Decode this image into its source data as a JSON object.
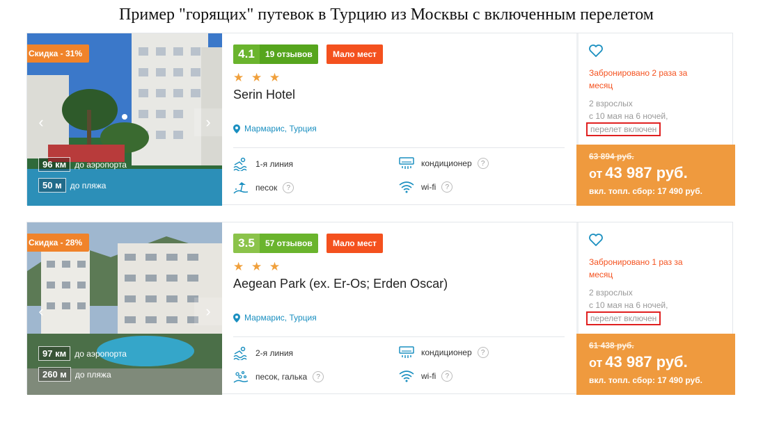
{
  "page": {
    "title": "Пример \"горящих\" путевок в Турцию из Москвы с включенным перелетом"
  },
  "labels": {
    "few_places": "Мало мест",
    "to_airport": "до аэропорта",
    "to_beach": "до пляжа",
    "question": "?"
  },
  "hotels": [
    {
      "discount": "Скидка - 31%",
      "rating": "4.1",
      "reviews": "19 отзывов",
      "stars": "★ ★ ★",
      "name": "Serin Hotel",
      "location": "Мармарис, Турция",
      "airport_km": "96 км",
      "beach_m": "50 м",
      "amenities": {
        "line": "1-я линия",
        "ac": "кондиционер",
        "beach": "песок",
        "wifi": "wi-fi"
      },
      "booked": "Забронировано 2 раза за месяц",
      "tourists": "2 взрослых",
      "dates": "с 10 мая на 6 ночей,",
      "flight": "перелет включен",
      "old_price": "63 894 руб.",
      "price_from": "от",
      "price": "43 987 руб.",
      "fee": "вкл. топл. сбор: 17 490 руб."
    },
    {
      "discount": "Скидка - 28%",
      "rating": "3.5",
      "reviews": "57 отзывов",
      "stars": "★ ★ ★",
      "name": "Aegean Park (ex. Er-Os; Erden Oscar)",
      "location": "Мармарис, Турция",
      "airport_km": "97 км",
      "beach_m": "260 м",
      "amenities": {
        "line": "2-я линия",
        "ac": "кондиционер",
        "beach": "песок, галька",
        "wifi": "wi-fi"
      },
      "booked": "Забронировано 1 раз за месяц",
      "tourists": "2 взрослых",
      "dates": "с 10 мая на 6 ночей,",
      "flight": "перелет включен",
      "old_price": "61 438 руб.",
      "price_from": "от",
      "price": "43 987 руб.",
      "fee": "вкл. топл. сбор: 17 490 руб."
    }
  ],
  "colors": {
    "accent_orange": "#ef9a3e",
    "badge_red": "#f4511e",
    "link_blue": "#1a8fc0",
    "rating_green": "#6ab42d"
  }
}
